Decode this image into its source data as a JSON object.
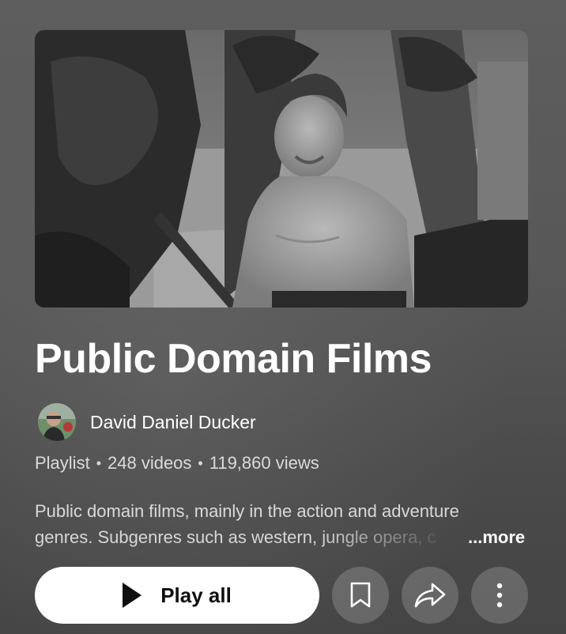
{
  "playlist": {
    "title": "Public Domain Films",
    "author": "David Daniel Ducker",
    "type_label": "Playlist",
    "video_count": "248 videos",
    "views": "119,860 views",
    "separator": "•",
    "description_line1": "Public domain films, mainly in the action and adventure",
    "description_line2": "genres. Subgenres such as western, jungle opera, c",
    "more_label": "...more"
  },
  "actions": {
    "play_all_label": "Play all",
    "play_icon": "play-icon",
    "save_icon": "bookmark-icon",
    "share_icon": "share-arrow-icon",
    "more_icon": "vertical-dots-icon"
  },
  "colors": {
    "background": "#575757",
    "primary_button_bg": "#ffffff",
    "primary_button_text": "#0f0f0f",
    "secondary_button_bg": "rgba(255,255,255,0.18)"
  }
}
